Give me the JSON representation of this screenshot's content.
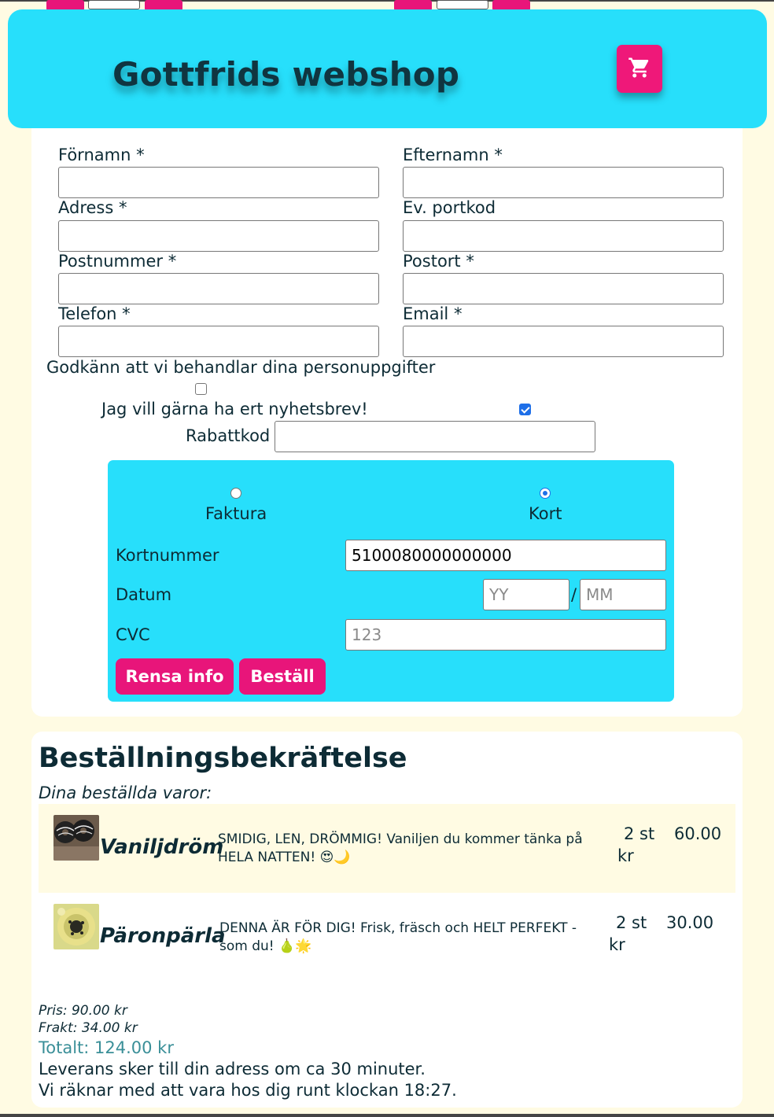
{
  "header": {
    "site_title": "Gottfrids webshop",
    "cart_icon": "shopping-cart-icon",
    "brand_color": "#27dffb",
    "accent_color": "#e8157a"
  },
  "form": {
    "first_name_label": "Förnamn *",
    "last_name_label": "Efternamn *",
    "address_label": "Adress *",
    "door_code_label": "Ev. portkod",
    "postal_code_label": "Postnummer *",
    "city_label": "Postort *",
    "phone_label": "Telefon *",
    "email_label": "Email *",
    "consent_label": "Godkänn att vi behandlar dina personuppgifter",
    "consent_checked": false,
    "newsletter_label": "Jag vill gärna ha ert nyhetsbrev!",
    "newsletter_checked": true,
    "discount_label": "Rabattkod"
  },
  "payment": {
    "invoice_label": "Faktura",
    "card_label": "Kort",
    "selected": "Kort",
    "card_number_label": "Kortnummer",
    "card_number_value": "5100080000000000",
    "date_label": "Datum",
    "year_placeholder": "YY",
    "date_separator": "/",
    "month_placeholder": "MM",
    "cvc_label": "CVC",
    "cvc_placeholder": "123",
    "clear_button": "Rensa info",
    "order_button": "Beställ"
  },
  "confirmation": {
    "title": "Beställningsbekräftelse",
    "subtitle": "Dina beställda varor:",
    "items": [
      {
        "name": "Vaniljdröm",
        "description": "SMIDIG, LEN, DRÖMMIG! Vaniljen du kommer tänka på HELA NATTEN! 😍🌙",
        "quantity": "2 st",
        "price": "60.00",
        "currency": "kr"
      },
      {
        "name": "Päronpärla",
        "description": "DENNA ÄR FÖR DIG! Frisk, fräsch och HELT PERFEKT - som du! 🍐🌟",
        "quantity": "2 st",
        "price": "30.00",
        "currency": "kr"
      }
    ],
    "price_line": "Pris: 90.00 kr",
    "shipping_line": "Frakt: 34.00 kr",
    "total_line": "Totalt: 124.00 kr",
    "delivery_line": "Leverans sker till din adress om ca 30 minuter.",
    "eta_line": "Vi räknar med att vara hos dig runt klockan 18:27."
  }
}
